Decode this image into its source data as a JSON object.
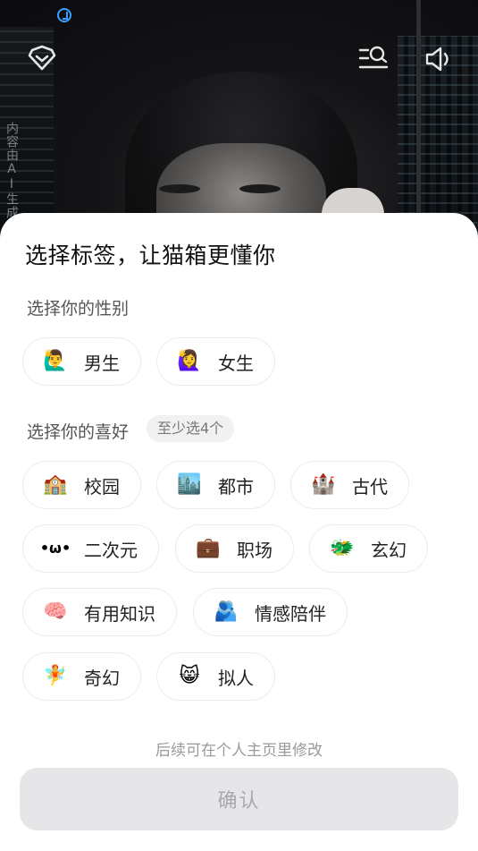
{
  "background": {
    "ai_notice": "内容由AI生成",
    "icons": [
      "heart-shield-icon",
      "search-list-icon",
      "speaker-icon"
    ]
  },
  "sheet": {
    "title": "选择标签，让猫箱更懂你",
    "gender_section": {
      "label": "选择你的性别",
      "options": [
        {
          "emoji": "🙋‍♂️",
          "label": "男生"
        },
        {
          "emoji": "🙋‍♀️",
          "label": "女生"
        }
      ]
    },
    "preference_section": {
      "label": "选择你的喜好",
      "hint": "至少选4个",
      "options": [
        {
          "emoji": "🏫",
          "label": "校园"
        },
        {
          "emoji": "🏙️",
          "label": "都市"
        },
        {
          "emoji": "🏰",
          "label": "古代"
        },
        {
          "emoji": "•ω•",
          "label": "二次元"
        },
        {
          "emoji": "💼",
          "label": "职场"
        },
        {
          "emoji": "🐲",
          "label": "玄幻"
        },
        {
          "emoji": "🧠",
          "label": "有用知识"
        },
        {
          "emoji": "🫂",
          "label": "情感陪伴"
        },
        {
          "emoji": "🧚",
          "label": "奇幻"
        },
        {
          "emoji": "😸",
          "label": "拟人"
        }
      ]
    },
    "footer_note": "后续可在个人主页里修改",
    "confirm_label": "确认"
  },
  "colors": {
    "accent_status": "#3aa0ff",
    "confirm_disabled_bg": "#e6e6e8",
    "confirm_disabled_text": "#a9a9ad"
  }
}
